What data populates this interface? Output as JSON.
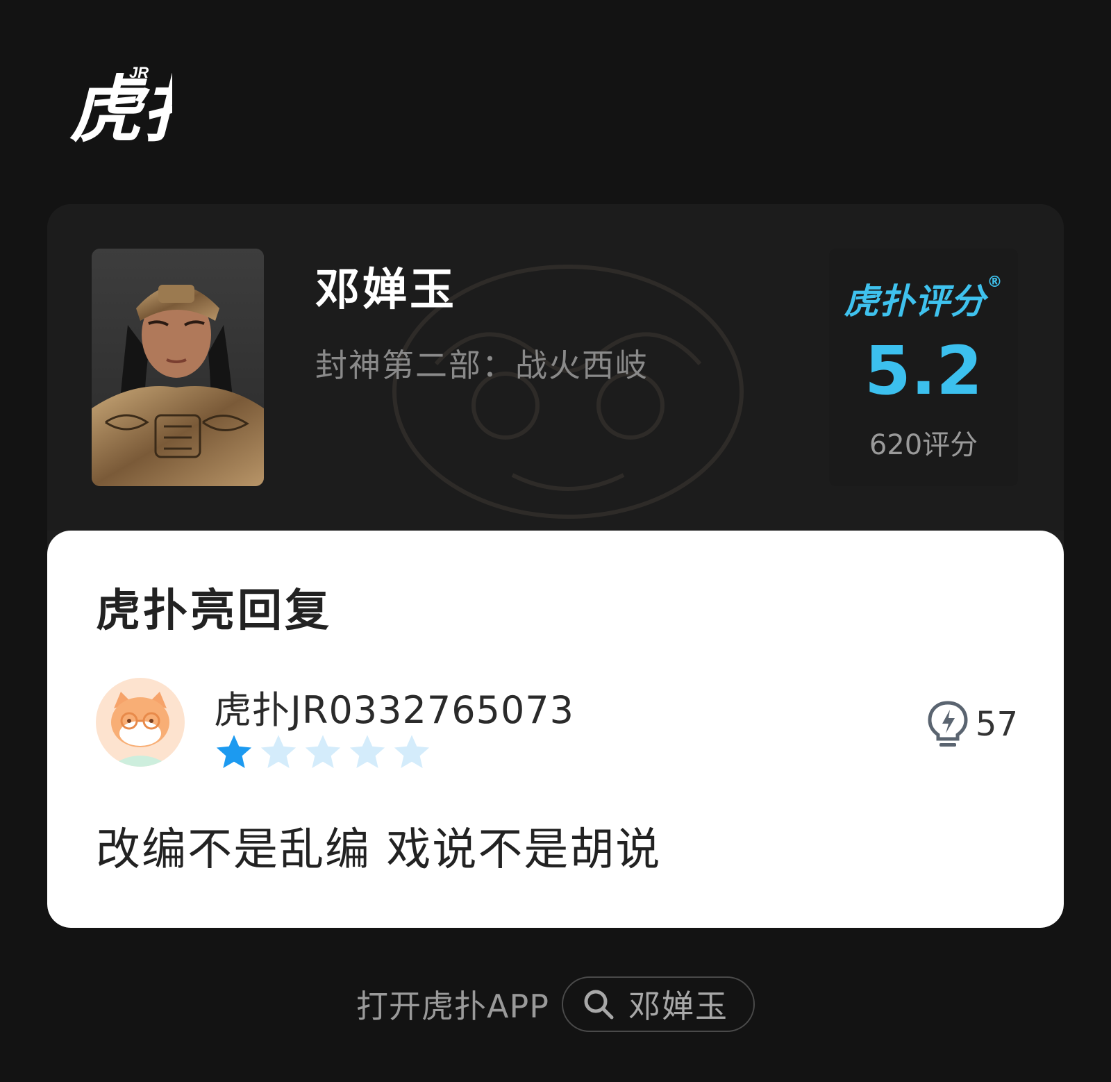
{
  "brand": {
    "logo_text": "虎扑",
    "logo_badge": "JR"
  },
  "item": {
    "name": "邓婵玉",
    "subtitle": "封神第二部：战火西岐"
  },
  "score": {
    "brand_label": "虎扑评分",
    "brand_reg": "®",
    "value": "5.2",
    "count_label": "620评分",
    "accent_color": "#3cc0ee"
  },
  "reply": {
    "heading": "虎扑亮回复",
    "username": "虎扑JR0332765073",
    "rating": 1,
    "rating_max": 5,
    "like_count": "57",
    "text": "改编不是乱编 戏说不是胡说"
  },
  "footer": {
    "open_app_label": "打开虎扑APP",
    "search_text": "邓婵玉"
  },
  "icons": [
    "hupu-logo",
    "poster-image",
    "avatar-cat",
    "star-icon",
    "lightbulb-like-icon",
    "search-icon"
  ]
}
